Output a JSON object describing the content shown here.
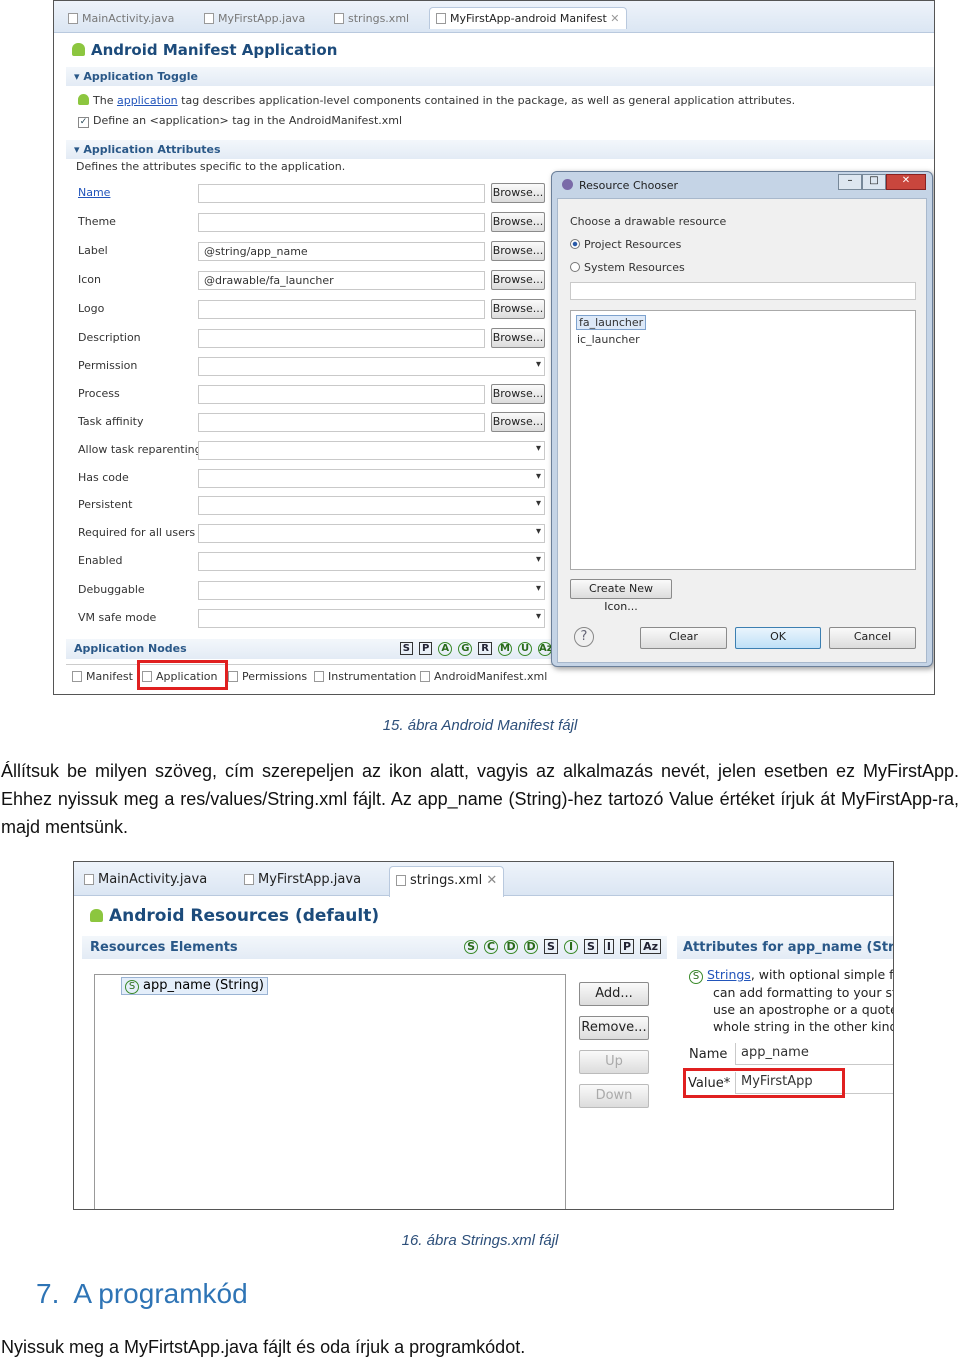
{
  "figure1": {
    "tabs": [
      "MainActivity.java",
      "MyFirstApp.java",
      "strings.xml",
      "MyFirstApp-android Manifest"
    ],
    "title": "Android Manifest Application",
    "toggle_header": "Application Toggle",
    "toggle_desc_pre": "The ",
    "toggle_link": "application",
    "toggle_desc_post": " tag describes application-level components contained in the package, as well as general application attributes.",
    "define_checkbox": "Define an <application> tag in the AndroidManifest.xml",
    "define_checked": true,
    "attrs_header": "Application Attributes",
    "attrs_desc": "Defines the attributes specific to the application.",
    "browse_label": "Browse...",
    "fields": [
      {
        "label": "Name",
        "value": "",
        "type": "browse",
        "link": true
      },
      {
        "label": "Theme",
        "value": "",
        "type": "browse"
      },
      {
        "label": "Label",
        "value": "@string/app_name",
        "type": "browse"
      },
      {
        "label": "Icon",
        "value": "@drawable/fa_launcher",
        "type": "browse"
      },
      {
        "label": "Logo",
        "value": "",
        "type": "browse"
      },
      {
        "label": "Description",
        "value": "",
        "type": "browse"
      },
      {
        "label": "Permission",
        "value": "",
        "type": "dropdown"
      },
      {
        "label": "Process",
        "value": "",
        "type": "browse"
      },
      {
        "label": "Task affinity",
        "value": "",
        "type": "browse"
      },
      {
        "label": "Allow task reparenting",
        "value": "",
        "type": "dropdown"
      },
      {
        "label": "Has code",
        "value": "",
        "type": "dropdown"
      },
      {
        "label": "Persistent",
        "value": "",
        "type": "dropdown"
      },
      {
        "label": "Required for all users",
        "value": "",
        "type": "dropdown"
      },
      {
        "label": "Enabled",
        "value": "",
        "type": "dropdown"
      },
      {
        "label": "Debuggable",
        "value": "",
        "type": "dropdown"
      },
      {
        "label": "VM safe mode",
        "value": "",
        "type": "dropdown"
      }
    ],
    "nodes_header": "Application Nodes",
    "node_icons": [
      "S",
      "P",
      "A",
      "G",
      "R",
      "M",
      "U",
      "Az"
    ],
    "bottom_tabs": [
      "Manifest",
      "Application",
      "Permissions",
      "Instrumentation",
      "AndroidManifest.xml"
    ],
    "dialog": {
      "title": "Resource Chooser",
      "prompt": "Choose a drawable resource",
      "radios": [
        {
          "label": "Project Resources",
          "checked": true
        },
        {
          "label": "System Resources",
          "checked": false
        }
      ],
      "filter": "",
      "items": [
        "fa_launcher",
        "ic_launcher"
      ],
      "selected": "fa_launcher",
      "create_button": "Create New Icon...",
      "help": "?",
      "buttons": [
        "Clear",
        "OK",
        "Cancel"
      ]
    }
  },
  "caption1": "15. ábra Android Manifest fájl",
  "paragraph1": "Állítsuk be milyen szöveg, cím szerepeljen az ikon alatt, vagyis az alkalmazás nevét, jelen esetben ez MyFirstApp. Ehhez nyissuk meg a res/values/String.xml fájlt. Az app_name (String)-hez tartozó Value értéket írjuk át MyFirstApp-ra, majd mentsünk.",
  "figure2": {
    "tabs": [
      "MainActivity.java",
      "MyFirstApp.java",
      "strings.xml"
    ],
    "title": "Android Resources (default)",
    "elements_header": "Resources Elements",
    "element_icons": [
      "S",
      "C",
      "D",
      "D",
      "S",
      "I",
      "S",
      "I",
      "P",
      "Az"
    ],
    "list_items": [
      "app_name (String)"
    ],
    "buttons": [
      "Add...",
      "Remove...",
      "Up",
      "Down"
    ],
    "attrs_header": "Attributes for app_name (String)",
    "desc_link": "Strings",
    "desc_lines": [
      ", with optional simple f",
      "can add formatting to your str",
      "use an apostrophe or a quote",
      "whole string in the other kind"
    ],
    "name_label": "Name",
    "name_value": "app_name",
    "value_label": "Value*",
    "value_value": "MyFirstApp",
    "highlight_color": "#e02020"
  },
  "caption2": "16. ábra Strings.xml fájl",
  "heading": "7.  A programkód",
  "paragraph2": "Nyissuk meg a MyFirtstApp.java fájlt és oda írjuk a programkódot."
}
